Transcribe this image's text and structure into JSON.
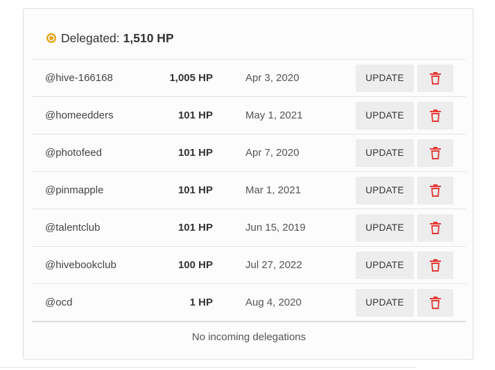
{
  "header": {
    "label": "Delegated:",
    "total": "1,510 HP",
    "icon": "hive-coin-icon",
    "icon_color": "#e8a317"
  },
  "delegations": [
    {
      "account": "@hive-166168",
      "amount": "1,005 HP",
      "date": "Apr 3, 2020",
      "update_label": "UPDATE"
    },
    {
      "account": "@homeedders",
      "amount": "101 HP",
      "date": "May 1, 2021",
      "update_label": "UPDATE"
    },
    {
      "account": "@photofeed",
      "amount": "101 HP",
      "date": "Apr 7, 2020",
      "update_label": "UPDATE"
    },
    {
      "account": "@pinmapple",
      "amount": "101 HP",
      "date": "Mar 1, 2021",
      "update_label": "UPDATE"
    },
    {
      "account": "@talentclub",
      "amount": "101 HP",
      "date": "Jun 15, 2019",
      "update_label": "UPDATE"
    },
    {
      "account": "@hivebookclub",
      "amount": "100 HP",
      "date": "Jul 27, 2022",
      "update_label": "UPDATE"
    },
    {
      "account": "@ocd",
      "amount": "1 HP",
      "date": "Aug 4, 2020",
      "update_label": "UPDATE"
    }
  ],
  "incoming": {
    "empty_text": "No incoming delegations"
  },
  "colors": {
    "delete_icon": "#e53935",
    "button_bg": "#ededed"
  }
}
